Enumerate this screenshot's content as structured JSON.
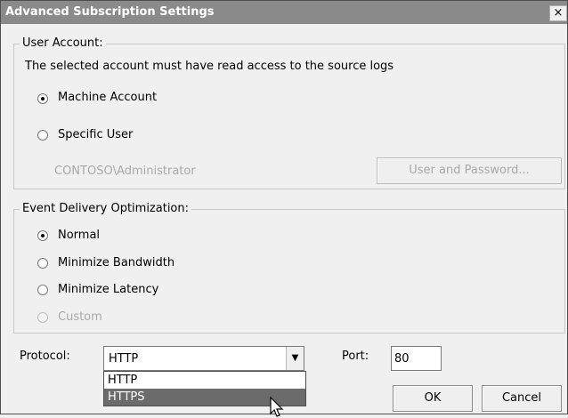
{
  "window": {
    "title": "Advanced Subscription Settings",
    "close_symbol": "×"
  },
  "user_account": {
    "group_label": "User Account:",
    "description": "The selected account must have read access to the source logs",
    "radios": [
      {
        "label": "Machine Account",
        "checked": true
      },
      {
        "label": "Specific User",
        "checked": false
      }
    ],
    "account_name": "CONTOSO\\Administrator",
    "user_password_button": "User and Password..."
  },
  "event_delivery": {
    "group_label": "Event Delivery Optimization:",
    "radios": [
      {
        "label": "Normal",
        "checked": true
      },
      {
        "label": "Minimize Bandwidth",
        "checked": false
      },
      {
        "label": "Minimize Latency",
        "checked": false
      },
      {
        "label": "Custom",
        "checked": false,
        "disabled": true
      }
    ]
  },
  "protocol": {
    "label": "Protocol:",
    "selected": "HTTP",
    "options": [
      "HTTP",
      "HTTPS"
    ],
    "highlighted": "HTTPS"
  },
  "port": {
    "label": "Port:",
    "value": "80"
  },
  "footer": {
    "ok_label": "OK",
    "cancel_label": "Cancel"
  },
  "icons": {
    "cursor": "mouse-pointer-icon",
    "dropdown": "chevron-down-icon",
    "close": "close-icon"
  }
}
